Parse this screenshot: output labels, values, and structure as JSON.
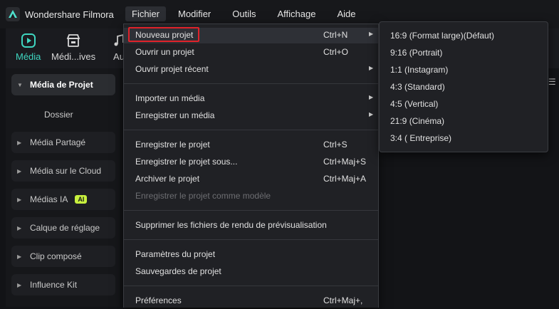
{
  "app": {
    "title": "Wondershare Filmora"
  },
  "menubar": [
    "Fichier",
    "Modifier",
    "Outils",
    "Affichage",
    "Aide"
  ],
  "toolbar": [
    {
      "label": "Média",
      "icon": "media-icon",
      "active": true
    },
    {
      "label": "Médi...ives",
      "icon": "stock-media-icon",
      "active": false
    },
    {
      "label": "Au",
      "icon": "music-note-icon",
      "active": false
    }
  ],
  "sidebar": {
    "items": [
      {
        "label": "Média de Projet",
        "selected": true
      },
      {
        "label": "Dossier",
        "sub": true
      },
      {
        "label": "Média Partagé"
      },
      {
        "label": "Média sur le Cloud"
      },
      {
        "label": "Médias IA",
        "badge": "AI"
      },
      {
        "label": "Calque de réglage"
      },
      {
        "label": "Clip composé"
      },
      {
        "label": "Influence Kit"
      }
    ]
  },
  "file_menu": {
    "items": [
      {
        "label": "Nouveau projet",
        "shortcut": "Ctrl+N",
        "submenu": true,
        "highlighted": true
      },
      {
        "label": "Ouvrir un projet",
        "shortcut": "Ctrl+O"
      },
      {
        "label": "Ouvrir projet récent",
        "shortcut": "",
        "submenu": true
      },
      {
        "label": "Importer un média",
        "shortcut": "",
        "submenu": true
      },
      {
        "label": "Enregistrer un média",
        "shortcut": "",
        "submenu": true
      },
      {
        "label": "Enregistrer le projet",
        "shortcut": "Ctrl+S"
      },
      {
        "label": "Enregistrer le projet sous...",
        "shortcut": "Ctrl+Maj+S"
      },
      {
        "label": "Archiver le projet",
        "shortcut": "Ctrl+Maj+A"
      },
      {
        "label": "Enregistrer le projet comme modèle",
        "shortcut": "",
        "disabled": true
      },
      {
        "label": "Supprimer les fichiers de rendu de prévisualisation",
        "shortcut": ""
      },
      {
        "label": "Paramètres du projet",
        "shortcut": ""
      },
      {
        "label": "Sauvegardes de projet",
        "shortcut": ""
      },
      {
        "label": "Préférences",
        "shortcut": "Ctrl+Maj+,"
      }
    ]
  },
  "new_project_submenu": [
    "16:9 (Format large)(Défaut)",
    "9:16 (Portrait)",
    "1:1 (Instagram)",
    "4:3 (Standard)",
    "4:5 (Vertical)",
    "21:9 (Cinéma)",
    "3:4 ( Entreprise)"
  ],
  "colors": {
    "accent": "#3fd6c0",
    "highlight_border": "#e0222a",
    "ai_badge": "#c8f03e"
  }
}
